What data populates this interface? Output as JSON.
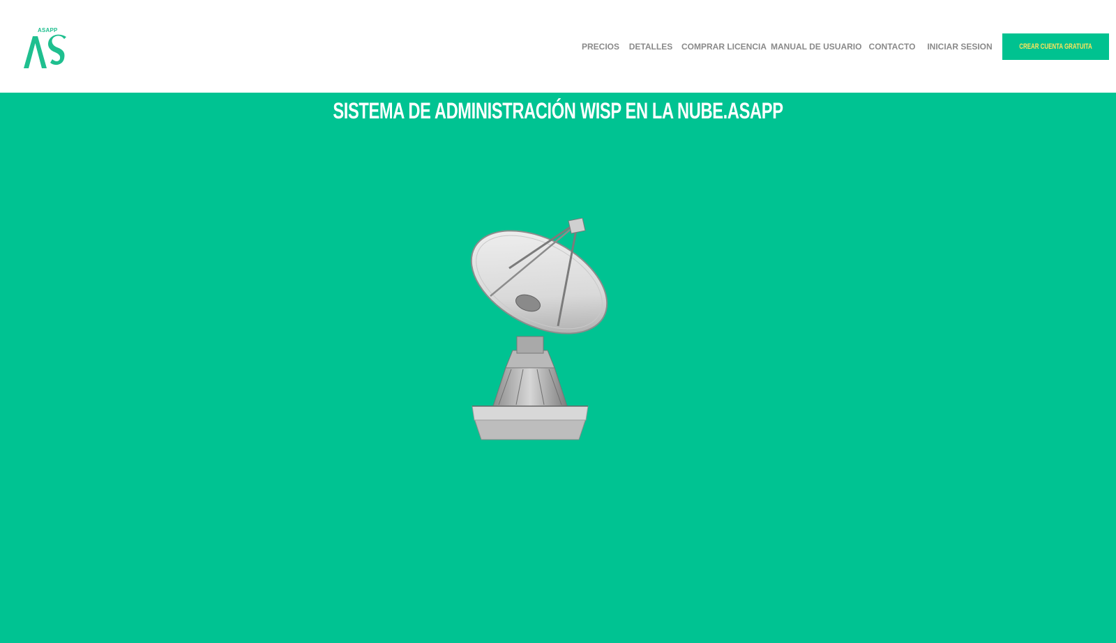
{
  "brand": {
    "small_label": "ASAPP",
    "logo_letters": "AS",
    "accent_color": "#00c392"
  },
  "nav": {
    "items": [
      {
        "label": "Precios"
      },
      {
        "label": "Detalles"
      },
      {
        "label": "Comprar Licencia"
      },
      {
        "label": "Manual de Usuario"
      },
      {
        "label": "Contacto"
      },
      {
        "label": "Iniciar Sesion"
      }
    ],
    "cta_label": "Crear cuenta gratuita"
  },
  "hero": {
    "title": "Sistema de Administración WISP en la nube.ASAPP",
    "image_icon": "satellite-dish-icon"
  }
}
